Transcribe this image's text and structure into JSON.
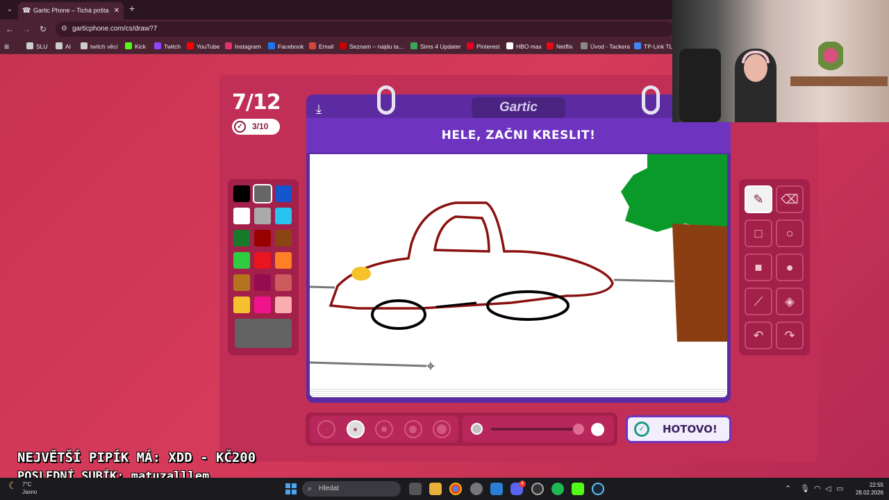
{
  "browser": {
    "tab_title": "Gartic Phone – Tichá pošta",
    "tab_close": "✕",
    "new_tab": "+",
    "url": "garticphone.com/cs/draw?7",
    "bookmarks": [
      {
        "label": "SLU",
        "color": "#cccccc"
      },
      {
        "label": "AI",
        "color": "#cccccc"
      },
      {
        "label": "twitch věci",
        "color": "#cccccc"
      },
      {
        "label": "Kick",
        "color": "#53fc18"
      },
      {
        "label": "Twitch",
        "color": "#9146ff"
      },
      {
        "label": "YouTube",
        "color": "#ff0000"
      },
      {
        "label": "Instagram",
        "color": "#e1306c"
      },
      {
        "label": "Facebook",
        "color": "#1877f2"
      },
      {
        "label": "Email",
        "color": "#d44638"
      },
      {
        "label": "Seznam – najdu ta...",
        "color": "#cc0000"
      },
      {
        "label": "Sims 4 Updater",
        "color": "#3aa757"
      },
      {
        "label": "Pinterest",
        "color": "#e60023"
      },
      {
        "label": "HBO max",
        "color": "#ffffff"
      },
      {
        "label": "Netflix",
        "color": "#e50914"
      },
      {
        "label": "Úvod - Tackera",
        "color": "#888888"
      },
      {
        "label": "TP-Link TL-",
        "color": "#4285f4"
      }
    ]
  },
  "game": {
    "round": "7/12",
    "checked": "3/10",
    "logo": "Gartic",
    "headline": "HELE, ZAČNI KRESLIT!",
    "done_label": "HOTOVO!",
    "colors": [
      "#000000",
      "#666666",
      "#1355cc",
      "#ffffff",
      "#aaaaaa",
      "#29c3f0",
      "#177a2a",
      "#990000",
      "#8b4513",
      "#2ecc40",
      "#e8141e",
      "#ff7f25",
      "#b5731f",
      "#950d50",
      "#cc5a5f",
      "#f6c12e",
      "#f0148c",
      "#fbacae"
    ],
    "selected_color": "#666666",
    "custom_color": "#636363",
    "brush_sizes": 5,
    "selected_brush_size": 2,
    "opacity_level": 1.0,
    "tools": [
      {
        "name": "pencil",
        "glyph": "✎",
        "active": true
      },
      {
        "name": "eraser",
        "glyph": "⌫",
        "active": false
      },
      {
        "name": "rectangle",
        "glyph": "□",
        "active": false
      },
      {
        "name": "ellipse",
        "glyph": "○",
        "active": false
      },
      {
        "name": "filled-rectangle",
        "glyph": "■",
        "active": false
      },
      {
        "name": "filled-ellipse",
        "glyph": "●",
        "active": false
      },
      {
        "name": "line",
        "glyph": "⟋",
        "active": false
      },
      {
        "name": "fill-bucket",
        "glyph": "◈",
        "active": false
      },
      {
        "name": "undo",
        "glyph": "↶",
        "active": false
      },
      {
        "name": "redo",
        "glyph": "↷",
        "active": false
      }
    ]
  },
  "overlay": {
    "line1": "NEJVĚTŠÍ PIPÍK MÁ: XDD - KČ200",
    "line2": "POSLEDNÍ SUBÍK: matuzalllem"
  },
  "taskbar": {
    "temp": "7°C",
    "weather": "Jasno",
    "search_placeholder": "Hledat",
    "time": "22:55",
    "date": "28.02.2026",
    "discord_badge": "4"
  }
}
